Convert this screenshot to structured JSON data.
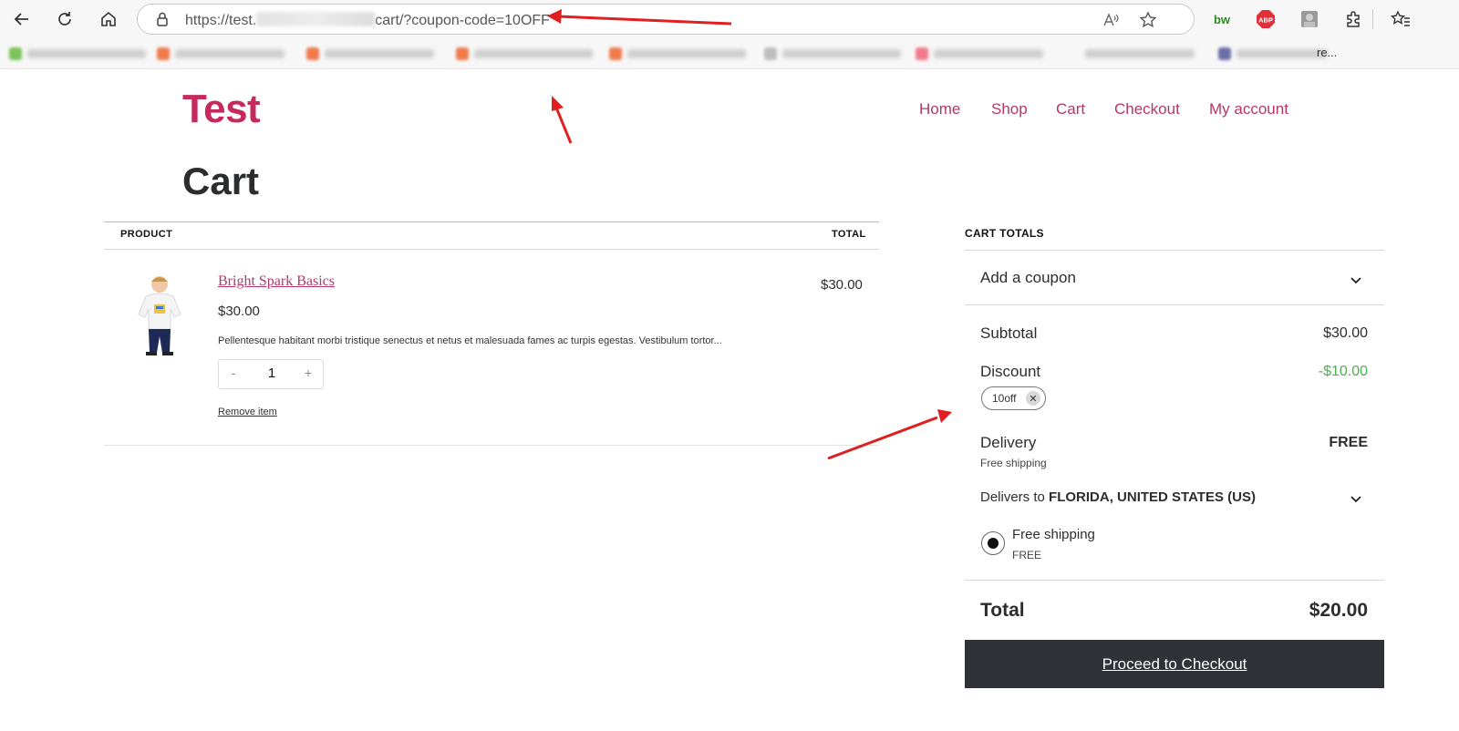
{
  "browser": {
    "url_prefix": "https://test.",
    "url_suffix": "cart/?coupon-code=10OFF",
    "bookmark_tail": "re..."
  },
  "site": {
    "title": "Test",
    "nav": [
      "Home",
      "Shop",
      "Cart",
      "Checkout",
      "My account"
    ]
  },
  "page": {
    "title": "Cart"
  },
  "table": {
    "header_product": "PRODUCT",
    "header_total": "TOTAL",
    "item": {
      "name": "Bright Spark Basics",
      "price": "$30.00",
      "description": "Pellentesque habitant morbi tristique senectus et netus et malesuada fames ac turpis egestas. Vestibulum tortor...",
      "quantity": "1",
      "qty_minus": "-",
      "qty_plus": "+",
      "line_total": "$30.00",
      "remove_label": "Remove item"
    }
  },
  "totals": {
    "heading": "CART TOTALS",
    "coupon_toggle": "Add a coupon",
    "subtotal_label": "Subtotal",
    "subtotal_value": "$30.00",
    "discount_label": "Discount",
    "discount_value": "-$10.00",
    "coupon_code": "10off",
    "delivery_label": "Delivery",
    "delivery_value": "FREE",
    "delivery_note": "Free shipping",
    "delivers_to_prefix": "Delivers to",
    "delivers_to_location": "FLORIDA, UNITED STATES (US)",
    "shipping_option": "Free shipping",
    "shipping_option_price": "FREE",
    "total_label": "Total",
    "total_value": "$20.00",
    "checkout_label": "Proceed to Checkout"
  },
  "colors": {
    "brand": "#c5295e",
    "link": "#b53668",
    "discount": "#4caf50",
    "button": "#2f3338",
    "annotation": "#e02020"
  },
  "icons": [
    "back-icon",
    "refresh-icon",
    "home-icon",
    "lock-icon",
    "read-aloud-icon",
    "favorite-star-icon",
    "extensions-icon",
    "favorites-icon",
    "chevron-down-icon",
    "remove-coupon-icon"
  ]
}
